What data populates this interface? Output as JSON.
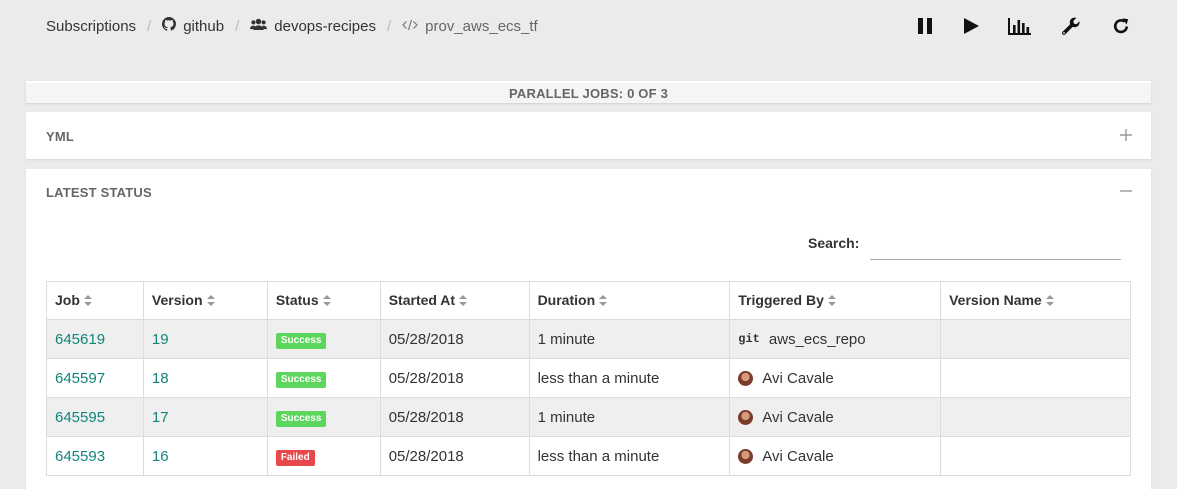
{
  "breadcrumb": {
    "subscriptions": "Subscriptions",
    "github": "github",
    "org": "devops-recipes",
    "repo": "prov_aws_ecs_tf"
  },
  "toolbar": {
    "icons": [
      "pause-icon",
      "play-icon",
      "chart-icon",
      "wrench-icon",
      "refresh-icon"
    ]
  },
  "parallel": {
    "label": "PARALLEL JOBS: 0 OF 3"
  },
  "yml": {
    "title": "YML",
    "toggle": "+"
  },
  "latest": {
    "title": "LATEST STATUS",
    "toggle": "−",
    "search_label": "Search:",
    "search_value": ""
  },
  "table": {
    "headers": [
      "Job",
      "Version",
      "Status",
      "Started At",
      "Duration",
      "Triggered By",
      "Version Name"
    ],
    "rows": [
      {
        "job": "645619",
        "version": "19",
        "status": "Success",
        "started": "05/28/2018",
        "duration": "1 minute",
        "trigger_icon": "git",
        "triggered_by": "aws_ecs_repo",
        "version_name": ""
      },
      {
        "job": "645597",
        "version": "18",
        "status": "Success",
        "started": "05/28/2018",
        "duration": "less than a minute",
        "trigger_icon": "avatar",
        "triggered_by": "Avi Cavale",
        "version_name": ""
      },
      {
        "job": "645595",
        "version": "17",
        "status": "Success",
        "started": "05/28/2018",
        "duration": "1 minute",
        "trigger_icon": "avatar",
        "triggered_by": "Avi Cavale",
        "version_name": ""
      },
      {
        "job": "645593",
        "version": "16",
        "status": "Failed",
        "started": "05/28/2018",
        "duration": "less than a minute",
        "trigger_icon": "avatar",
        "triggered_by": "Avi Cavale",
        "version_name": ""
      }
    ]
  },
  "colors": {
    "link": "#11847c",
    "success": "#5dd65d",
    "failed": "#e8474c"
  }
}
